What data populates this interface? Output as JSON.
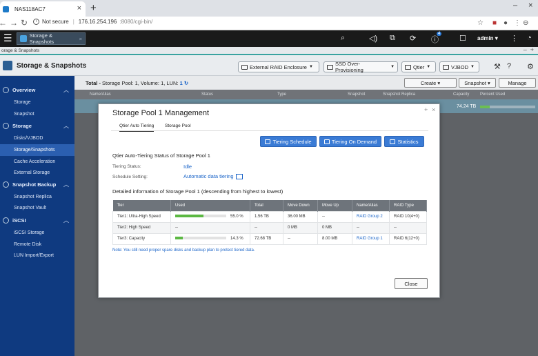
{
  "browser": {
    "tab_title": "NAS118AC7",
    "security": "Not secure",
    "url_host": "176.16.254.196",
    "url_rest": ":8080/cgi-bin/"
  },
  "qts": {
    "app_tab": "Storage & Snapshots",
    "notif_count": "4",
    "user": "admin",
    "breadcrumb": "orage & Snapshots"
  },
  "app": {
    "title": "Storage & Snapshots",
    "toolbar": [
      "External RAID Enclosure",
      "SSD Over-Provisioning",
      "Qtier",
      "VJBOD"
    ]
  },
  "sidebar": {
    "sections": [
      {
        "label": "Overview",
        "items": [
          "Storage",
          "Snapshot"
        ]
      },
      {
        "label": "Storage",
        "items": [
          "Disks/VJBOD",
          "Storage/Snapshots",
          "Cache Acceleration",
          "External Storage"
        ]
      },
      {
        "label": "Snapshot Backup",
        "items": [
          "Snapshot Replica",
          "Snapshot Vault"
        ]
      },
      {
        "label": "iSCSI",
        "items": [
          "iSCSI Storage",
          "Remote Disk",
          "LUN Import/Export"
        ]
      }
    ]
  },
  "content": {
    "total_label": "Total -",
    "total_detail": "Storage Pool: 1, Volume: 1, LUN:",
    "lun_count": "1",
    "buttons": [
      "Create",
      "Snapshot",
      "Manage"
    ],
    "columns": [
      "Name/Alias",
      "Status",
      "Type",
      "Snapshot",
      "Snapshot Replica",
      "Capacity",
      "Percent Used"
    ],
    "row_capacity": "74.24 TB",
    "row_percent_used": 0.17
  },
  "modal": {
    "title": "Storage Pool 1 Management",
    "tabs": [
      "Qtier Auto Tiering",
      "Storage Pool"
    ],
    "actions": [
      "Tiering Schedule",
      "Tiering On Demand",
      "Statistics"
    ],
    "status_title": "Qtier Auto-Tiering Status of Storage Pool 1",
    "tiering_status_label": "Tiering Status:",
    "tiering_status_value": "Idle",
    "schedule_label": "Schedule Setting:",
    "schedule_value": "Automatic data tiering",
    "detail_title": "Detailed information of Storage Pool 1 (descending from highest to lowest)",
    "table": {
      "headers": [
        "Tier",
        "Used",
        "Total",
        "Move Down",
        "Move Up",
        "Name/Alias",
        "RAID Type"
      ],
      "rows": [
        {
          "tier": "Tier1: Ultra-High Speed",
          "used_pct_text": "55.0 %",
          "used_fraction": 0.55,
          "total": "1.56 TB",
          "move_down": "36.00 MB",
          "move_up": "--",
          "name": "RAID Group 2",
          "raid": "RAID 10(4+0)"
        },
        {
          "tier": "Tier2: High Speed",
          "used_pct_text": "--",
          "used_fraction": 0,
          "total": "--",
          "move_down": "0 MB",
          "move_up": "0 MB",
          "name": "--",
          "raid": "--"
        },
        {
          "tier": "Tier3: Capacity",
          "used_pct_text": "14.3 %",
          "used_fraction": 0.143,
          "total": "72.68 TB",
          "move_down": "--",
          "move_up": "8.00 MB",
          "name": "RAID Group 1",
          "raid": "RAID 6(12+0)"
        }
      ]
    },
    "note": "Note: You still need proper spare disks and backup plan to protect tiered data.",
    "close": "Close"
  }
}
